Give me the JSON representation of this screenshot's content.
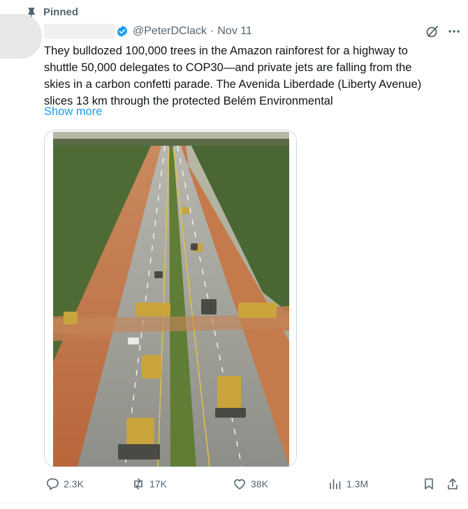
{
  "pinned": {
    "label": "Pinned",
    "icon": "pin-icon"
  },
  "author": {
    "handle": "@PeterDClack",
    "date": "Nov 11",
    "separator": "·",
    "verified_color": "#1d9bf0"
  },
  "tweet": {
    "lines": [
      "They bulldozed 100,000 trees in the Amazon rainforest for a highway to",
      "shuttle 50,000 delegates to COP30—and private jets are falling from the",
      "skies in a carbon confetti parade. The Avenida Liberdade (Liberty Avenue)",
      "slices 13 km through the protected Belém Environmental"
    ],
    "show_more": "Show more"
  },
  "media": {
    "description_icon": "highway-construction-photo"
  },
  "actions": {
    "replies": "2.3K",
    "reposts": "17K",
    "likes": "38K",
    "views": "1.3M"
  },
  "colors": {
    "accent": "#1d9bf0",
    "muted": "#536471",
    "text": "#0f1419"
  }
}
